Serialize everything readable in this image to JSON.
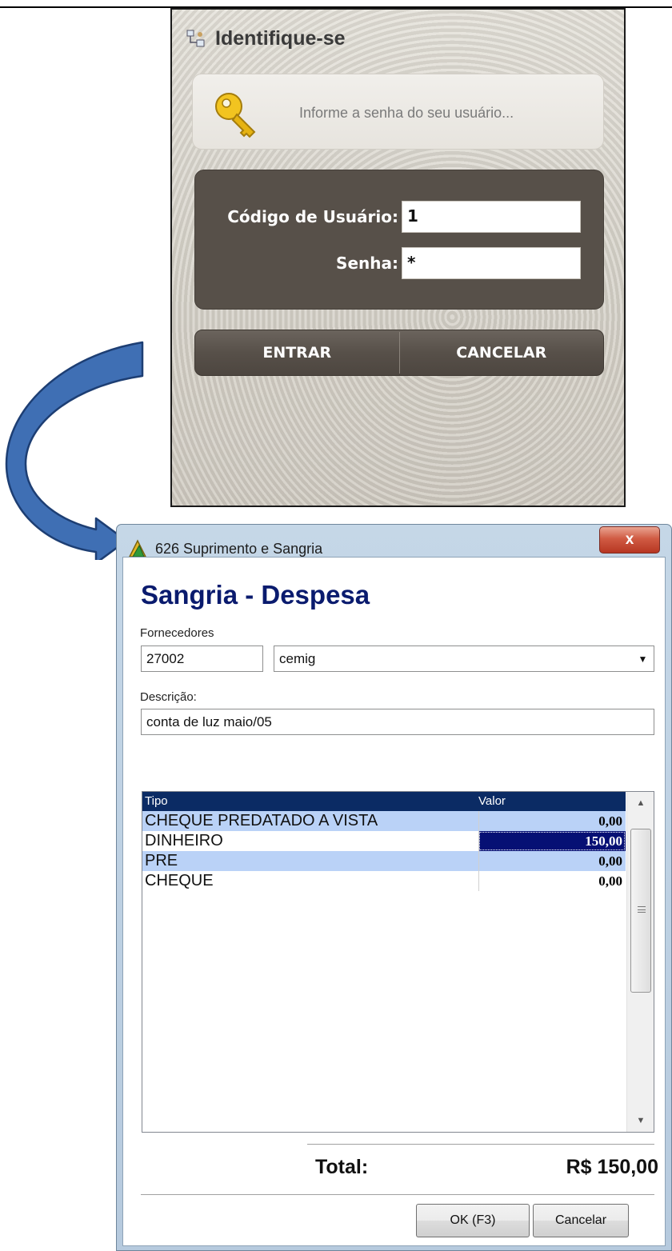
{
  "login": {
    "title": "Identifique-se",
    "hint": "Informe a senha do seu usuário...",
    "user_code_label": "Código de Usuário:",
    "user_code_value": "1",
    "password_label": "Senha:",
    "password_value": "*",
    "enter_label": "ENTRAR",
    "cancel_label": "CANCELAR"
  },
  "window": {
    "title": "626 Suprimento e Sangria",
    "close_glyph": "x",
    "heading": "Sangria - Despesa",
    "supplier_label": "Fornecedores",
    "supplier_code": "27002",
    "supplier_name": "cemig",
    "description_label": "Descrição:",
    "description_value": "conta de luz maio/05",
    "grid": {
      "columns": [
        "Tipo",
        "Valor"
      ],
      "rows": [
        {
          "tipo": "CHEQUE PREDATADO A VISTA",
          "valor": "0,00"
        },
        {
          "tipo": "DINHEIRO",
          "valor": "150,00"
        },
        {
          "tipo": "PRE",
          "valor": "0,00"
        },
        {
          "tipo": "CHEQUE",
          "valor": "0,00"
        }
      ]
    },
    "total_label": "Total:",
    "total_value": "R$ 150,00",
    "ok_label": "OK (F3)",
    "cancel_label": "Cancelar"
  },
  "colors": {
    "heading": "#0a1b6e",
    "grid_header": "#0b2b64",
    "selected_cell": "#061074",
    "alt_row": "#bad2f7",
    "arrow_fill": "#3f6fb4"
  }
}
